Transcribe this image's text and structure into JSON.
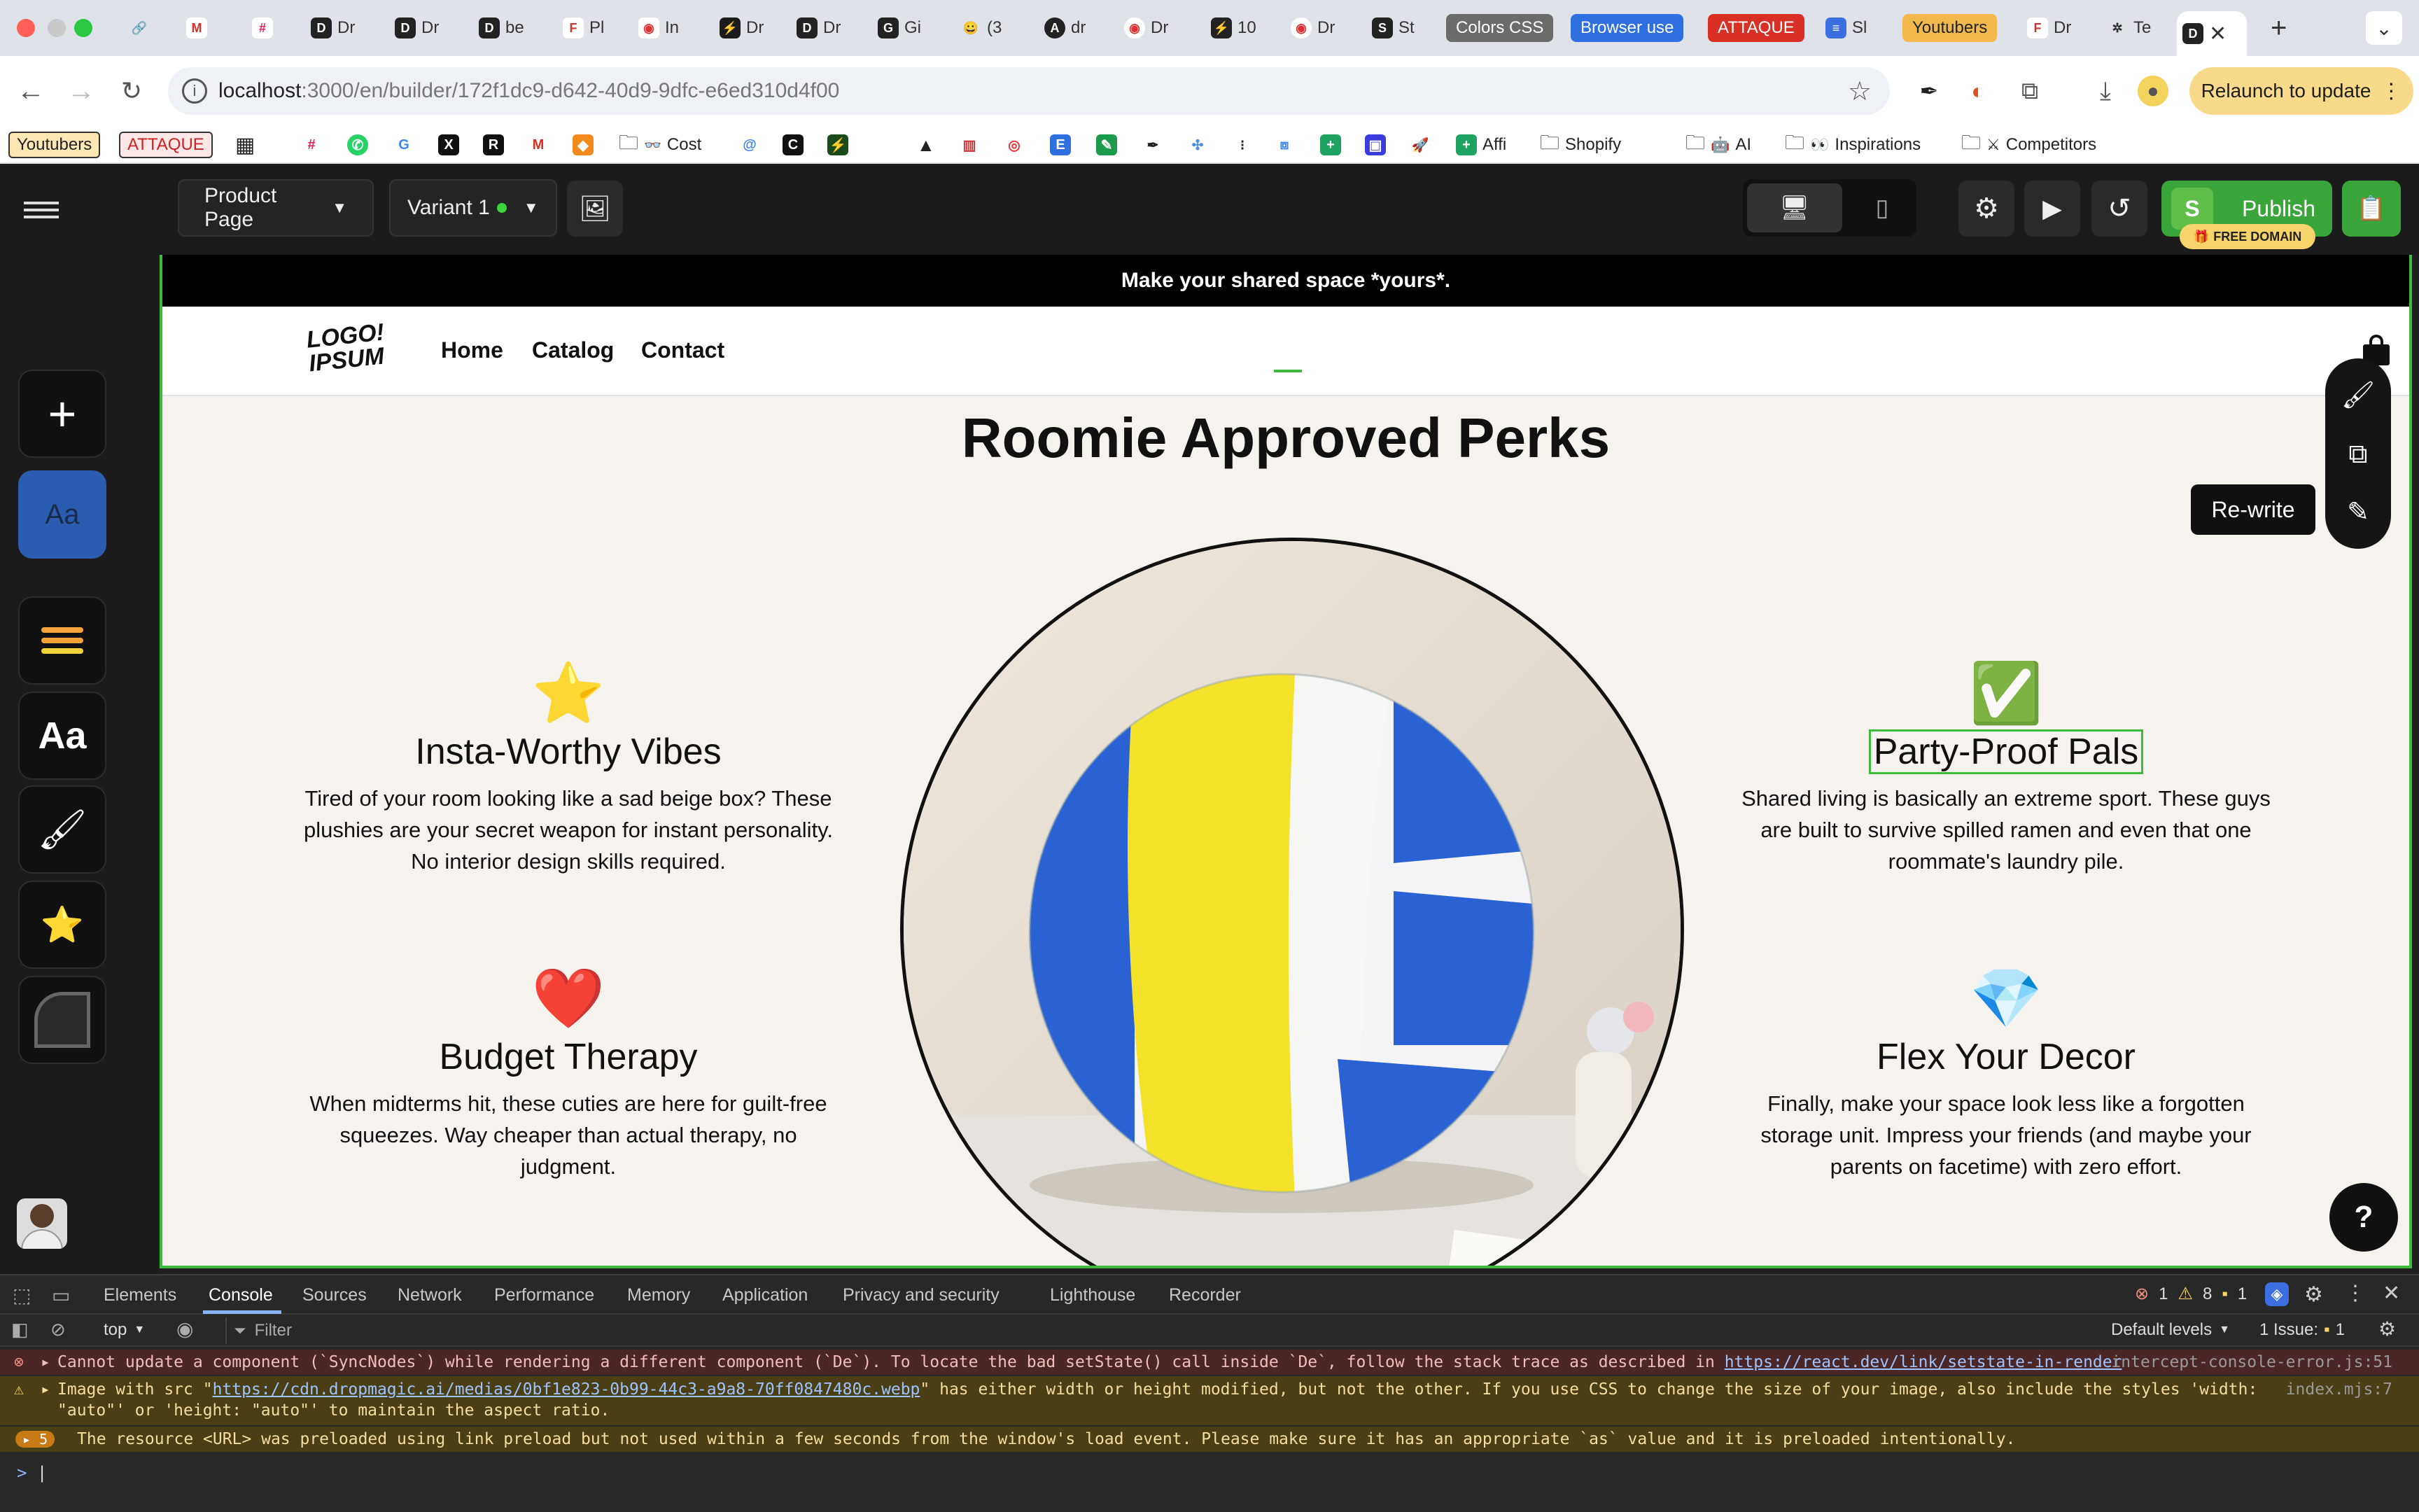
{
  "browser": {
    "tabs": [
      {
        "label": "Dr"
      },
      {
        "label": "Dr"
      },
      {
        "label": "be"
      },
      {
        "label": "Pl"
      },
      {
        "label": "In"
      },
      {
        "label": "Dr"
      },
      {
        "label": "Dr"
      },
      {
        "label": "Gi"
      },
      {
        "label": "(3"
      },
      {
        "label": "dr"
      },
      {
        "label": "Dr"
      },
      {
        "label": "10"
      },
      {
        "label": "Dr"
      },
      {
        "label": "St"
      },
      {
        "label": "Sl"
      },
      {
        "label": "Dr"
      },
      {
        "label": "Te"
      }
    ],
    "pill_tabs": [
      {
        "label": "Colors CSS",
        "color": "#6b6b6b"
      },
      {
        "label": "Browser use",
        "color": "#2f6fe0"
      },
      {
        "label": "ATTAQUE",
        "color": "#d93025"
      },
      {
        "label": "Youtubers",
        "color": "#f2b84b"
      }
    ],
    "url_host": "localhost",
    "url_path": ":3000/en/builder/172f1dc9-d642-40d9-9dfc-e6ed310d4f00",
    "relaunch_label": "Relaunch to update",
    "bookmarks": [
      {
        "label": "Youtubers"
      },
      {
        "label": "ATTAQUE"
      },
      {
        "label": "Cost"
      },
      {
        "label": "Affi"
      },
      {
        "label": "Shopify"
      },
      {
        "label": "AI"
      },
      {
        "label": "Inspirations"
      },
      {
        "label": "Competitors"
      }
    ]
  },
  "builder": {
    "page_select": "Product Page",
    "variant_select": "Variant 1",
    "publish_label": "Publish",
    "free_domain_badge": "FREE DOMAIN",
    "rewrite_tooltip": "Re-write",
    "help_label": "?",
    "rail_font_label": "Aa"
  },
  "site": {
    "announcement": "Make your shared space *yours*.",
    "logo_line1": "LOGO!",
    "logo_line2": "IPSUM",
    "nav": [
      {
        "label": "Home"
      },
      {
        "label": "Catalog"
      },
      {
        "label": "Contact"
      }
    ],
    "section_title": "Roomie Approved Perks",
    "features": [
      {
        "icon": "⭐",
        "title": "Insta-Worthy Vibes",
        "text": "Tired of your room looking like a sad beige box? These plushies are your secret weapon for instant personality. No interior design skills required."
      },
      {
        "icon": "❤️",
        "title": "Budget Therapy",
        "text": "When midterms hit, these cuties are here for guilt-free squeezes. Way cheaper than actual therapy, no judgment."
      },
      {
        "icon": "✅",
        "title": "Party-Proof Pals",
        "text": "Shared living is basically an extreme sport. These guys are built to survive spilled ramen and even that one roommate's laundry pile."
      },
      {
        "icon": "💎",
        "title": "Flex Your Decor",
        "text": "Finally, make your space look less like a forgotten storage unit. Impress your friends (and maybe your parents on facetime) with zero effort."
      }
    ]
  },
  "devtools": {
    "tabs": [
      {
        "label": "Elements"
      },
      {
        "label": "Console"
      },
      {
        "label": "Sources"
      },
      {
        "label": "Network"
      },
      {
        "label": "Performance"
      },
      {
        "label": "Memory"
      },
      {
        "label": "Application"
      },
      {
        "label": "Privacy and security"
      },
      {
        "label": "Lighthouse"
      },
      {
        "label": "Recorder"
      }
    ],
    "counts": {
      "errors": "1",
      "warnings": "8",
      "info": "1"
    },
    "context": "top",
    "filter_placeholder": "Filter",
    "levels": "Default levels",
    "issues": "1 Issue:",
    "issues_count": "1",
    "logs": [
      {
        "text_a": "Cannot update a component (`SyncNodes`) while rendering a different component (`De`). To locate the bad setState() call inside `De`, follow the stack trace as described in ",
        "link": "https://react.dev/link/setstate-in-render",
        "source": "intercept-console-error.js:51"
      },
      {
        "text_a": "Image with src \"",
        "link": "https://cdn.dropmagic.ai/medias/0bf1e823-0b99-44c3-a9a8-70ff0847480c.webp",
        "text_b": "\" has either width or height modified, but not the other. If you use CSS to change the size of your image, also include the styles 'width: \"auto\"' or 'height: \"auto\"' to maintain the aspect ratio.",
        "source": "index.mjs:7"
      },
      {
        "count": "5",
        "text_a": "The resource <URL> was preloaded using link preload but not used within a few seconds from the window's load event. Please make sure it has an appropriate `as` value and it is preloaded intentionally."
      }
    ],
    "prompt": ">"
  }
}
